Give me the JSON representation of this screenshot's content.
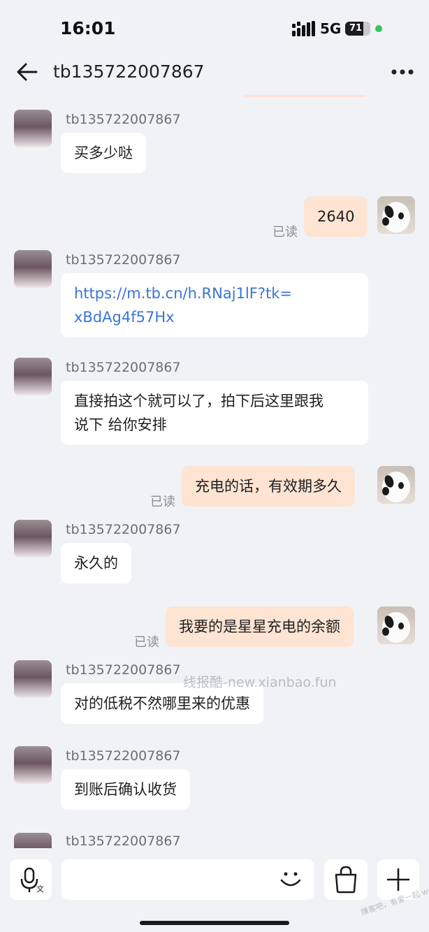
{
  "status_bar": {
    "time": "16:01",
    "network": "5G",
    "battery": "71",
    "battery_level": 0.71
  },
  "header": {
    "title": "tb135722007867"
  },
  "messages": [
    {
      "sender": "tb135722007867",
      "text": "买多少哒"
    },
    {
      "text": "2640",
      "status": "已读"
    },
    {
      "sender": "tb135722007867",
      "line1": "https://m.tb.cn/h.RNaj1lF?tk=",
      "line2": "xBdAg4f57Hx"
    },
    {
      "sender": "tb135722007867",
      "line1": "直接拍这个就可以了，拍下后这里跟我",
      "line2": "说下 给你安排"
    },
    {
      "text": "充电的话，有效期多久",
      "status": "已读"
    },
    {
      "sender": "tb135722007867",
      "text": "永久的"
    },
    {
      "text": "我要的是星星充电的余额",
      "status": "已读"
    },
    {
      "sender": "tb135722007867",
      "text": "对的低税不然哪里来的优惠"
    },
    {
      "sender": "tb135722007867",
      "text": "到账后确认收货"
    },
    {
      "sender": "tb135722007867"
    }
  ],
  "watermark": "线报酷-new.xianbao.fun",
  "corner_watermark": "赚客吧，有爱一起 www.zuanke8.com",
  "icons": {
    "back": "arrow-left-icon",
    "more": "more-dots-icon",
    "voice": "voice-to-text-icon",
    "emoji": "smiley-icon",
    "cart": "shopping-bag-icon",
    "plus": "plus-icon"
  },
  "colors": {
    "self_bubble": "#fde4d3",
    "other_bubble": "#ffffff",
    "link": "#3a74d6",
    "background": "#f1f2f6"
  }
}
